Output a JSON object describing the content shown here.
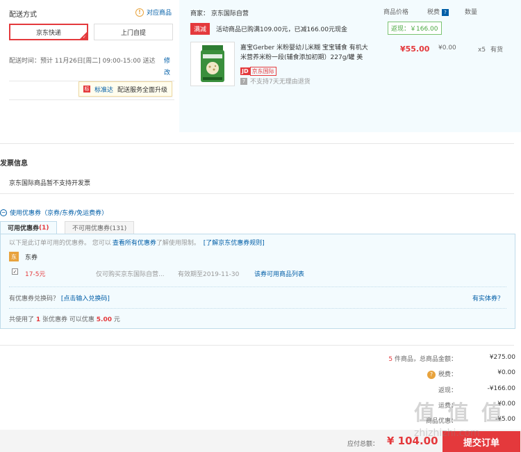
{
  "delivery": {
    "title": "配送方式",
    "match_link": "对应商品",
    "options": [
      "京东快递",
      "上门自提"
    ],
    "time_label": "配送时间：预计 11月26日[周二] 09:00-15:00 送达",
    "modify_link": "修改",
    "badge_tag": "标准达",
    "badge_text": "配送服务全面升级"
  },
  "product": {
    "seller": "商家： 京东国际自营",
    "headers": {
      "price": "商品价格",
      "tax": "税费",
      "qty": "数量"
    },
    "promo_tag": "满减",
    "promo_text": "活动商品已购满109.00元，已减166.00元现金",
    "rebate": "返现：￥166.00",
    "name": "嘉宝Gerber 米粉婴幼儿米糊 宝宝辅食 有机大米营养米粉一段(辅食添加初期）227g/罐 美",
    "jd_logo": "JD",
    "jd_text": "京东国际",
    "no_return": "不支持7天无理由退货",
    "price": "¥55.00",
    "tax": "¥0.00",
    "qty": "x5",
    "stock": "有货"
  },
  "invoice": {
    "title": "发票信息",
    "text": "京东国际商品暂不支持开发票"
  },
  "coupons": {
    "header": "使用优惠券（京券/东券/免运费券）",
    "tab_available": "可用优惠券",
    "tab_available_count": "(1)",
    "tab_unavailable": "不可用优惠券(131)",
    "note": "以下是此订单可用的优惠券。 您可以",
    "note_link": "查看所有优惠券",
    "note_mid": "了解使用限制。",
    "note_link2": "[了解京东优惠券规则]",
    "type_icon": "东",
    "type_label": "东券",
    "item_amount": "17-5元",
    "item_desc": "仅可购买京东国际自营...",
    "item_valid": "有效期至2019-11-30",
    "item_link": "该券可用商品列表",
    "redeem_text": "有优惠券兑换码？",
    "redeem_link": "[点击输入兑换码]",
    "physical_link": "有实体券？",
    "summary_pre": "共使用了",
    "summary_count": "1",
    "summary_mid": "张优惠券   可以优惠",
    "summary_amount": "5.00",
    "summary_post": "元"
  },
  "summary": {
    "count": "5",
    "goods_label": "件商品，总商品金额：",
    "goods_value": "¥275.00",
    "tax_label": "税费：",
    "tax_value": "¥0.00",
    "rebate_label": "返现：",
    "rebate_value": "-¥166.00",
    "freight_label": "运费：",
    "freight_value": "¥0.00",
    "discount_label": "商品优惠：",
    "discount_value": "-¥5.00"
  },
  "footer": {
    "total_label": "应付总额：",
    "total_value": "¥ 104.00",
    "submit": "提交订单"
  },
  "watermark": {
    "main": "值 值 值",
    "sub": "zhizhizhi.com"
  }
}
